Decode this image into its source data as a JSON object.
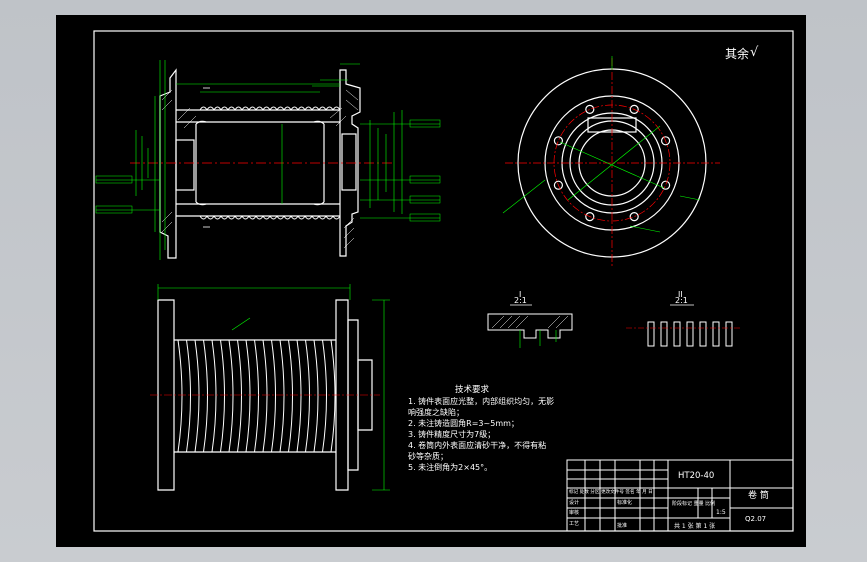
{
  "drawing": {
    "top_right_mark": "其余",
    "surface_symbol": "√",
    "section_I_label": "I",
    "section_I_scale": "2:1",
    "section_II_label": "II",
    "section_II_scale": "2:1",
    "tech_requirements": {
      "title": "技术要求",
      "items": [
        "1. 铸件表面应光整，内部组织均匀，无影",
        "   响强度之缺陷；",
        "2. 未注铸造圆角R=3~5mm；",
        "3. 铸件精度尺寸为7级；",
        "4. 卷筒内外表面应清砂干净，不得有粘",
        "   砂等杂质；",
        "5. 未注倒角为2×45°。"
      ]
    },
    "title_block": {
      "material": "HT20-40",
      "name": "卷 筒",
      "scale": "1:5",
      "drawing_no": "Q2.07",
      "sheet_info": "共 1 张  第 1 张",
      "revision_row": "标记 处数 分区 更改文件号 签名 年 月 日",
      "stage_scale_header": "阶段标记  重量  比例",
      "designer_label": "设计",
      "standard_label": "标准化",
      "approve_label": "批准",
      "review_label": "审核",
      "process_label": "工艺"
    }
  },
  "colors": {
    "background": "#000000",
    "outline": "#ffffff",
    "dimension": "#00ff00",
    "centerline": "#ff0000",
    "border": "#ffffff"
  }
}
